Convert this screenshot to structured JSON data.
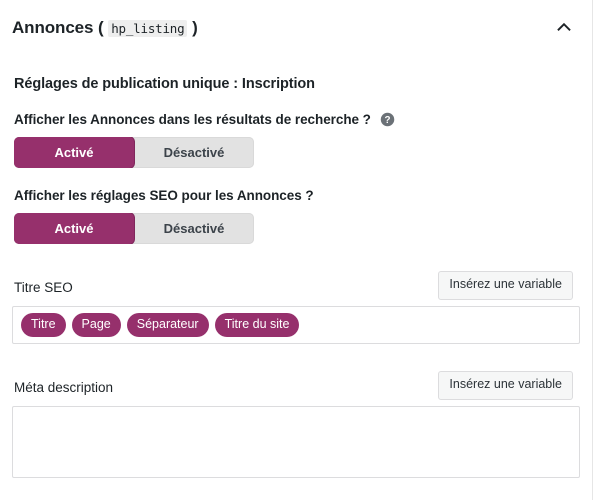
{
  "panel": {
    "title_text": "Annonces",
    "title_open_paren": "(",
    "title_code": "hp_listing",
    "title_close_paren": ")",
    "collapse_icon": "chevron-up-icon"
  },
  "section": {
    "heading": "Réglages de publication unique : Inscription"
  },
  "toggles": [
    {
      "label": "Afficher les Annonces dans les résultats de recherche ?",
      "has_help_icon": true,
      "help_icon": "help-circle-icon",
      "on_label": "Activé",
      "off_label": "Désactivé",
      "selected": "Activé"
    },
    {
      "label": "Afficher les réglages SEO pour les Annonces ?",
      "has_help_icon": false,
      "on_label": "Activé",
      "off_label": "Désactivé",
      "selected": "Activé"
    }
  ],
  "seo_title": {
    "label": "Titre SEO",
    "insert_variable_label": "Insérez une variable",
    "tags": [
      "Titre",
      "Page",
      "Séparateur",
      "Titre du site"
    ]
  },
  "meta_description": {
    "label": "Méta description",
    "insert_variable_label": "Insérez une variable",
    "value": "",
    "placeholder": ""
  },
  "colors": {
    "accent": "#96306c",
    "toggle_track": "#e2e2e2",
    "border": "#dcdcde",
    "text": "#1d2327"
  }
}
